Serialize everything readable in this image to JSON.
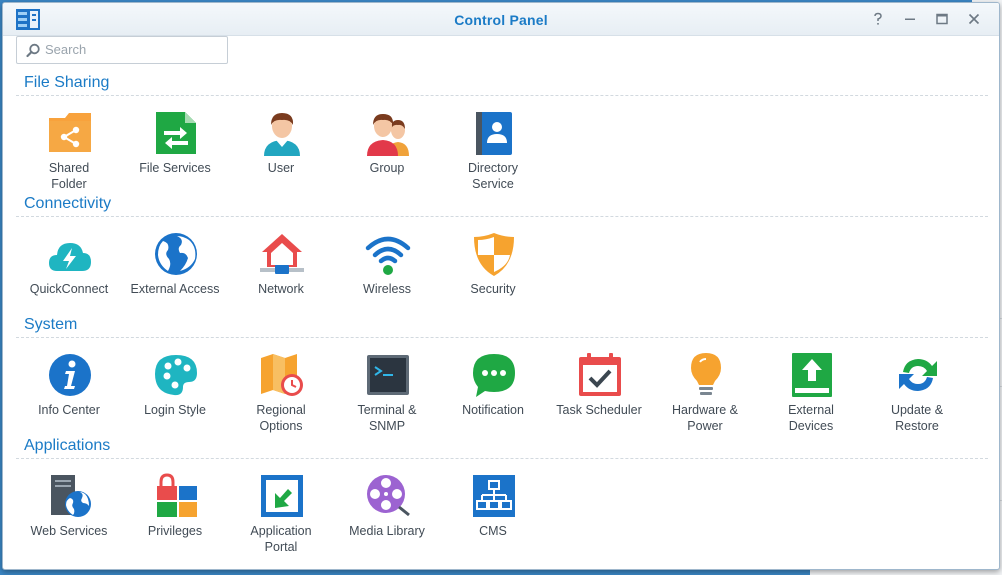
{
  "window": {
    "title": "Control Panel"
  },
  "search": {
    "placeholder": "Search"
  },
  "sections": [
    {
      "title": "File Sharing",
      "items": [
        {
          "label": "Shared\nFolder",
          "icon": "shared-folder-icon"
        },
        {
          "label": "File Services",
          "icon": "file-services-icon"
        },
        {
          "label": "User",
          "icon": "user-icon"
        },
        {
          "label": "Group",
          "icon": "group-icon"
        },
        {
          "label": "Directory\nService",
          "icon": "directory-service-icon"
        }
      ]
    },
    {
      "title": "Connectivity",
      "items": [
        {
          "label": "QuickConnect",
          "icon": "quickconnect-icon"
        },
        {
          "label": "External Access",
          "icon": "external-access-icon"
        },
        {
          "label": "Network",
          "icon": "network-icon"
        },
        {
          "label": "Wireless",
          "icon": "wireless-icon"
        },
        {
          "label": "Security",
          "icon": "security-icon"
        }
      ]
    },
    {
      "title": "System",
      "items": [
        {
          "label": "Info Center",
          "icon": "info-center-icon"
        },
        {
          "label": "Login Style",
          "icon": "login-style-icon"
        },
        {
          "label": "Regional\nOptions",
          "icon": "regional-options-icon"
        },
        {
          "label": "Terminal &\nSNMP",
          "icon": "terminal-icon"
        },
        {
          "label": "Notification",
          "icon": "notification-icon"
        },
        {
          "label": "Task Scheduler",
          "icon": "task-scheduler-icon"
        },
        {
          "label": "Hardware &\nPower",
          "icon": "hardware-power-icon"
        },
        {
          "label": "External\nDevices",
          "icon": "external-devices-icon"
        },
        {
          "label": "Update &\nRestore",
          "icon": "update-restore-icon"
        }
      ]
    },
    {
      "title": "Applications",
      "items": [
        {
          "label": "Web Services",
          "icon": "web-services-icon"
        },
        {
          "label": "Privileges",
          "icon": "privileges-icon"
        },
        {
          "label": "Application\nPortal",
          "icon": "application-portal-icon"
        },
        {
          "label": "Media Library",
          "icon": "media-library-icon"
        },
        {
          "label": "CMS",
          "icon": "cms-icon"
        }
      ]
    }
  ],
  "colors": {
    "accent": "#1b7bc6",
    "desktop": "#3b86c4",
    "label": "#414b55"
  }
}
